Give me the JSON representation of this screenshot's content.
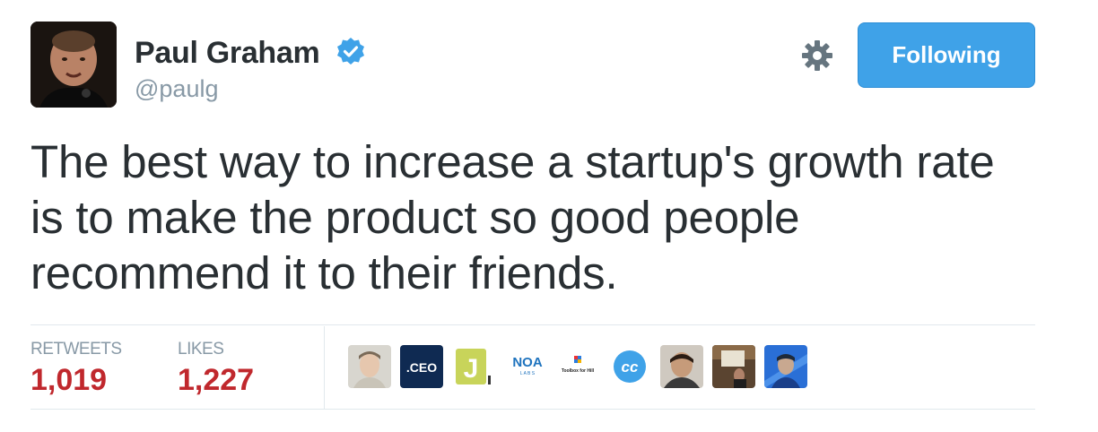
{
  "user": {
    "name": "Paul Graham",
    "handle": "@paulg"
  },
  "follow_button": {
    "label": "Following"
  },
  "tweet": {
    "lines": [
      "The best way to increase a startup's growth rate",
      "is to make the product so good people",
      "recommend it to their friends."
    ]
  },
  "stats": {
    "retweets_label": "RETWEETS",
    "retweets_value": "1,019",
    "likes_label": "LIKES",
    "likes_value": "1,227"
  },
  "likers": {
    "ceo_text": ".CEO",
    "j_text": "J",
    "noa_text": "NOA",
    "noa_sub": "L A B S",
    "toolbox_text": "Toolbox for Hill",
    "cc_text": "cc"
  },
  "colors": {
    "follow_button": "#3fa2e8",
    "stat_value": "#c0282d",
    "verified_badge": "#3fa2e8",
    "muted_text": "#8899a6"
  },
  "icons": [
    "verified-badge-icon",
    "gear-icon"
  ]
}
